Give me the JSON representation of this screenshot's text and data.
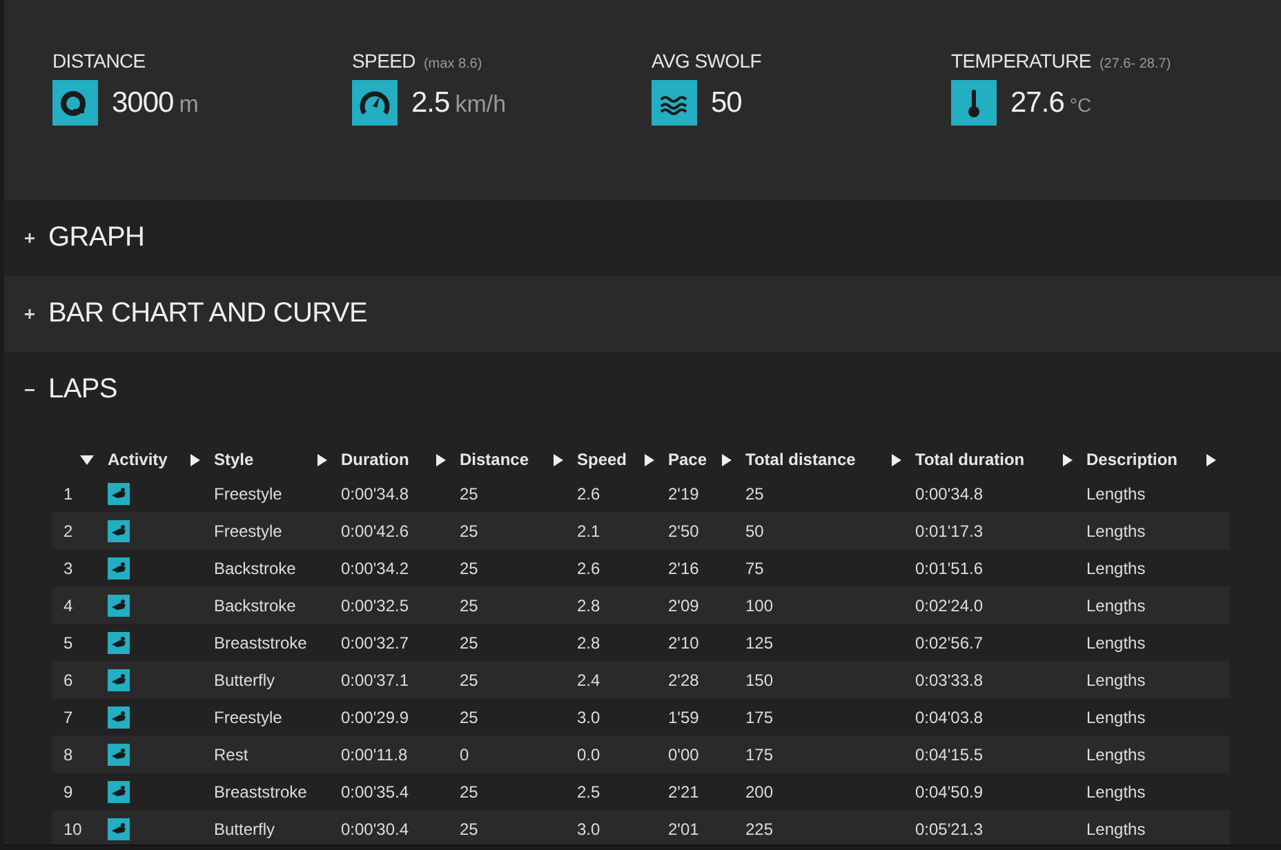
{
  "stats": [
    {
      "kind": "distance",
      "label": "DISTANCE",
      "value": "3000",
      "unit": "m"
    },
    {
      "kind": "speed",
      "label": "SPEED",
      "note": "(max 8.6)",
      "value": "2.5",
      "unit": "km/h"
    },
    {
      "kind": "swolf",
      "label": "AVG SWOLF",
      "value": "50"
    },
    {
      "kind": "temperature",
      "label": "TEMPERATURE",
      "note": "(27.6- 28.7)",
      "value": "27.6",
      "unit": "°C"
    }
  ],
  "sections": [
    {
      "title": "GRAPH",
      "expanded": false
    },
    {
      "title": "BAR CHART AND CURVE",
      "expanded": false
    },
    {
      "title": "LAPS",
      "expanded": true
    }
  ],
  "table": {
    "columns": [
      {
        "kind": "index",
        "sorted": true
      },
      {
        "label": "Activity",
        "kind": "icon",
        "sorted": false
      },
      {
        "label": "Style",
        "sorted": false
      },
      {
        "label": "Duration",
        "sorted": false
      },
      {
        "label": "Distance",
        "sorted": false
      },
      {
        "label": "Speed",
        "sorted": false
      },
      {
        "label": "Pace",
        "sorted": false
      },
      {
        "label": "Total distance",
        "sorted": false
      },
      {
        "label": "Total duration",
        "sorted": false
      },
      {
        "label": "Description",
        "sorted": false
      }
    ],
    "rows": [
      [
        "1",
        "",
        "Freestyle",
        "0:00'34.8",
        "25",
        "2.6",
        "2'19",
        "25",
        "0:00'34.8",
        "Lengths"
      ],
      [
        "2",
        "",
        "Freestyle",
        "0:00'42.6",
        "25",
        "2.1",
        "2'50",
        "50",
        "0:01'17.3",
        "Lengths"
      ],
      [
        "3",
        "",
        "Backstroke",
        "0:00'34.2",
        "25",
        "2.6",
        "2'16",
        "75",
        "0:01'51.6",
        "Lengths"
      ],
      [
        "4",
        "",
        "Backstroke",
        "0:00'32.5",
        "25",
        "2.8",
        "2'09",
        "100",
        "0:02'24.0",
        "Lengths"
      ],
      [
        "5",
        "",
        "Breaststroke",
        "0:00'32.7",
        "25",
        "2.8",
        "2'10",
        "125",
        "0:02'56.7",
        "Lengths"
      ],
      [
        "6",
        "",
        "Butterfly",
        "0:00'37.1",
        "25",
        "2.4",
        "2'28",
        "150",
        "0:03'33.8",
        "Lengths"
      ],
      [
        "7",
        "",
        "Freestyle",
        "0:00'29.9",
        "25",
        "3.0",
        "1'59",
        "175",
        "0:04'03.8",
        "Lengths"
      ],
      [
        "8",
        "",
        "Rest",
        "0:00'11.8",
        "0",
        "0.0",
        "0'00",
        "175",
        "0:04'15.5",
        "Lengths"
      ],
      [
        "9",
        "",
        "Breaststroke",
        "0:00'35.4",
        "25",
        "2.5",
        "2'21",
        "200",
        "0:04'50.9",
        "Lengths"
      ],
      [
        "10",
        "",
        "Butterfly",
        "0:00'30.4",
        "25",
        "3.0",
        "2'01",
        "225",
        "0:05'21.3",
        "Lengths"
      ]
    ]
  }
}
